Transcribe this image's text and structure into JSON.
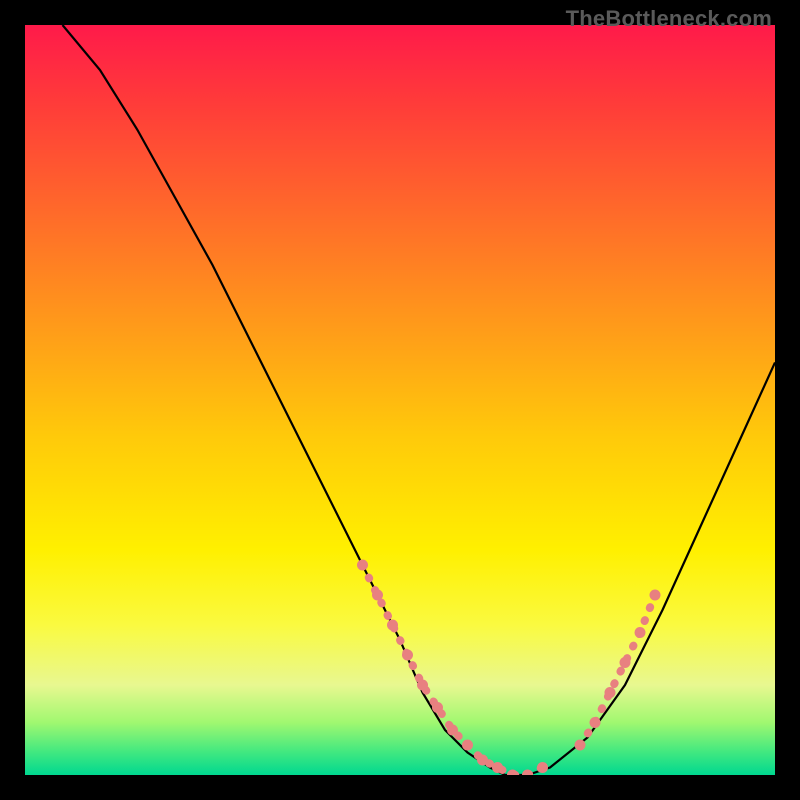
{
  "watermark": "TheBottleneck.com",
  "chart_data": {
    "type": "line",
    "title": "",
    "xlabel": "",
    "ylabel": "",
    "xlim": [
      0,
      100
    ],
    "ylim": [
      0,
      100
    ],
    "series": [
      {
        "name": "bottleneck-curve",
        "x": [
          5,
          10,
          15,
          20,
          25,
          30,
          35,
          40,
          45,
          50,
          53,
          56,
          59,
          62,
          64,
          67,
          70,
          75,
          80,
          85,
          90,
          95,
          100
        ],
        "y": [
          100,
          94,
          86,
          77,
          68,
          58,
          48,
          38,
          28,
          18,
          11,
          6,
          3,
          1,
          0,
          0,
          1,
          5,
          12,
          22,
          33,
          44,
          55
        ],
        "color": "#000000"
      }
    ],
    "marker_segments": [
      {
        "name": "left-pink-segment",
        "color": "#e88080",
        "points_xy": [
          [
            45,
            28
          ],
          [
            47,
            24
          ],
          [
            49,
            20
          ],
          [
            51,
            16
          ],
          [
            53,
            12
          ],
          [
            55,
            9
          ],
          [
            57,
            6
          ],
          [
            59,
            4
          ],
          [
            61,
            2
          ],
          [
            63,
            1
          ],
          [
            65,
            0
          ],
          [
            67,
            0
          ],
          [
            69,
            1
          ]
        ]
      },
      {
        "name": "right-pink-segment",
        "color": "#e88080",
        "points_xy": [
          [
            74,
            4
          ],
          [
            76,
            7
          ],
          [
            78,
            11
          ],
          [
            80,
            15
          ],
          [
            82,
            19
          ],
          [
            84,
            24
          ]
        ]
      }
    ],
    "background_gradient": {
      "stops": [
        {
          "pos": 0,
          "color": "#ff1a4a"
        },
        {
          "pos": 25,
          "color": "#ff6a2a"
        },
        {
          "pos": 55,
          "color": "#ffca0a"
        },
        {
          "pos": 80,
          "color": "#fafa40"
        },
        {
          "pos": 97,
          "color": "#40e880"
        },
        {
          "pos": 100,
          "color": "#00d890"
        }
      ]
    }
  }
}
